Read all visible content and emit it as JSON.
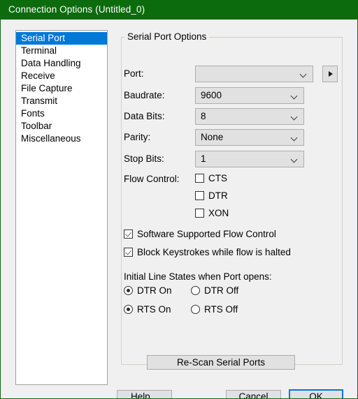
{
  "window": {
    "title": "Connection Options (Untitled_0)",
    "titlebar_color": "#0c6b0c",
    "accent_color": "#0078d7"
  },
  "sidebar": {
    "items": [
      {
        "label": "Serial Port",
        "selected": true
      },
      {
        "label": "Terminal",
        "selected": false
      },
      {
        "label": "Data Handling",
        "selected": false
      },
      {
        "label": "Receive",
        "selected": false
      },
      {
        "label": "File Capture",
        "selected": false
      },
      {
        "label": "Transmit",
        "selected": false
      },
      {
        "label": "Fonts",
        "selected": false
      },
      {
        "label": "Toolbar",
        "selected": false
      },
      {
        "label": "Miscellaneous",
        "selected": false
      }
    ]
  },
  "group": {
    "legend": "Serial Port Options",
    "fields": [
      {
        "label": "Port:",
        "value": ""
      },
      {
        "label": "Baudrate:",
        "value": "9600"
      },
      {
        "label": "Data Bits:",
        "value": "8"
      },
      {
        "label": "Parity:",
        "value": "None"
      },
      {
        "label": "Stop Bits:",
        "value": "1"
      }
    ],
    "flow_control": {
      "label": "Flow Control:",
      "options": [
        {
          "label": "CTS",
          "checked": false
        },
        {
          "label": "DTR",
          "checked": false
        },
        {
          "label": "XON",
          "checked": false
        }
      ]
    },
    "software_flow": [
      {
        "label": "Software Supported Flow Control",
        "checked": true
      },
      {
        "label": "Block Keystrokes while flow is halted",
        "checked": true
      }
    ],
    "initial_line_states": {
      "heading": "Initial Line States when Port opens:",
      "options": [
        {
          "label": "DTR On",
          "selected": true
        },
        {
          "label": "DTR Off",
          "selected": false
        },
        {
          "label": "RTS On",
          "selected": true
        },
        {
          "label": "RTS Off",
          "selected": false
        }
      ]
    },
    "rescan_label": "Re-Scan Serial Ports",
    "port_extra_icon": "triangle-right-icon"
  },
  "footer": {
    "help_label": "Help...",
    "cancel_label": "Cancel",
    "ok_label": "OK"
  }
}
